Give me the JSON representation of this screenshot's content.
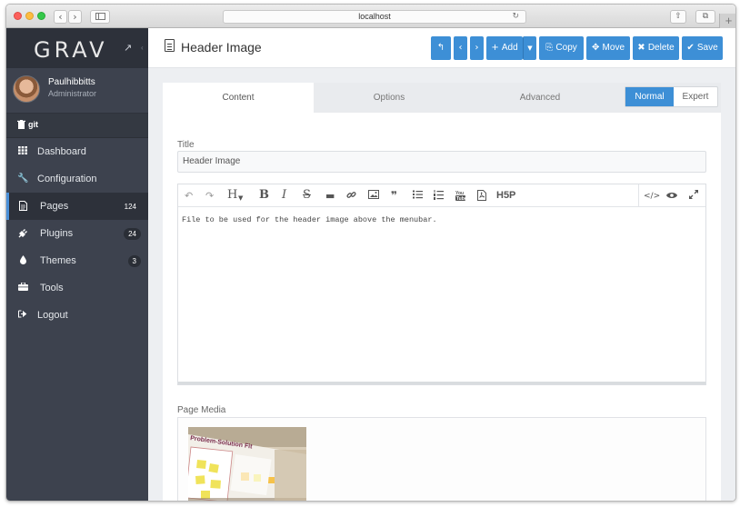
{
  "browser": {
    "url": "localhost"
  },
  "sidebar": {
    "logo": "GRAV",
    "user": {
      "name": "Paulhibbitts",
      "role": "Administrator"
    },
    "git_label": "git",
    "items": [
      {
        "label": "Dashboard",
        "icon": "grid-icon",
        "badge": ""
      },
      {
        "label": "Configuration",
        "icon": "wrench-icon",
        "badge": ""
      },
      {
        "label": "Pages",
        "icon": "file-icon",
        "badge": "124"
      },
      {
        "label": "Plugins",
        "icon": "plug-icon",
        "badge": "24"
      },
      {
        "label": "Themes",
        "icon": "tint-icon",
        "badge": "3"
      },
      {
        "label": "Tools",
        "icon": "briefcase-icon",
        "badge": ""
      },
      {
        "label": "Logout",
        "icon": "sign-out-icon",
        "badge": ""
      }
    ]
  },
  "header": {
    "title": "Header Image",
    "toolbar": {
      "add": "Add",
      "copy": "Copy",
      "move": "Move",
      "delete": "Delete",
      "save": "Save"
    }
  },
  "tabs": {
    "content": "Content",
    "options": "Options",
    "advanced": "Advanced"
  },
  "mode": {
    "normal": "Normal",
    "expert": "Expert"
  },
  "form": {
    "title_label": "Title",
    "title_value": "Header Image",
    "editor_text": "File to be used for the header image above the menubar.",
    "h5p_label": "H5P",
    "media_label": "Page Media"
  },
  "colors": {
    "accent": "#3d8fd6",
    "sidebar_bg": "#3d424e",
    "sidebar_dark": "#2d313a"
  }
}
